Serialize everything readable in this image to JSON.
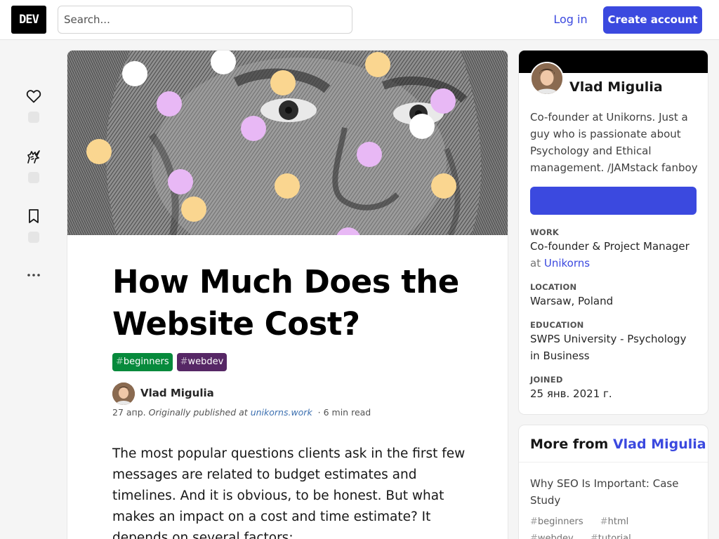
{
  "header": {
    "logo": "DEV",
    "search_placeholder": "Search...",
    "login_label": "Log in",
    "create_account_label": "Create account"
  },
  "sidebar": {
    "reactions": [
      {
        "icon": "heart-icon"
      },
      {
        "icon": "unicorn-icon"
      },
      {
        "icon": "bookmark-icon"
      }
    ],
    "more_icon": "ellipsis-icon"
  },
  "article": {
    "title": "How Much Does the Website Cost?",
    "tags": [
      {
        "hash": "#",
        "name": "beginners",
        "color": "#078a3c"
      },
      {
        "hash": "#",
        "name": "webdev",
        "color": "#562765"
      }
    ],
    "author": "Vlad Migulia",
    "date": "27 апр.",
    "originally_published": "Originally published at",
    "source_link": "unikorns.work",
    "read_time": "6 min read",
    "intro": "The most popular questions clients ask in the first few messages are related to budget estimates and timelines. And it is obvious, to be honest. But what makes an impact on a cost and time estimate? It depends on several factors:"
  },
  "profile": {
    "name": "Vlad Migulia",
    "bio": "Co-founder at Unikorns. Just a guy who is passionate about Psychology and Ethical management. /JAMstack fanboy",
    "fields": {
      "work_label": "WORK",
      "work_value": "Co-founder & Project Manager",
      "work_at": "at",
      "work_company": "Unikorns",
      "location_label": "LOCATION",
      "location_value": "Warsaw, Poland",
      "education_label": "EDUCATION",
      "education_value": "SWPS University - Psychology in Business",
      "joined_label": "JOINED",
      "joined_value": "25 янв. 2021 г."
    }
  },
  "more_from": {
    "prefix": "More from",
    "author": "Vlad Migulia",
    "posts": [
      {
        "title": "Why SEO Is Important: Case Study",
        "tags": [
          "beginners",
          "html",
          "webdev",
          "tutorial"
        ]
      }
    ]
  },
  "colors": {
    "accent": "#3b49df",
    "tag_beginners": "#078a3c",
    "tag_webdev": "#562765"
  }
}
